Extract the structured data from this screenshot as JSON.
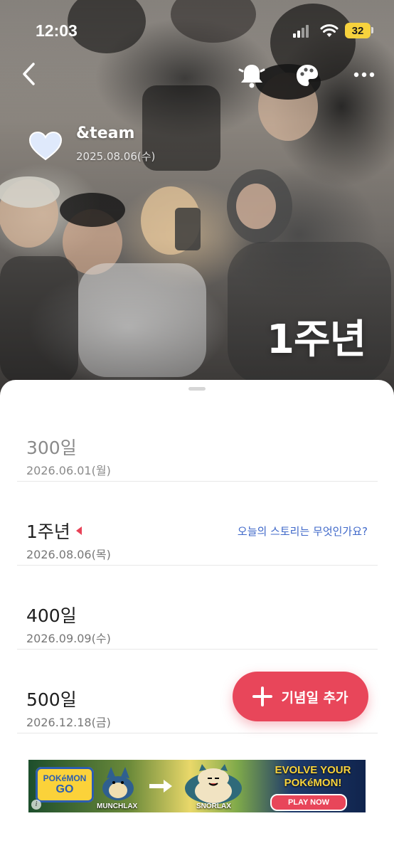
{
  "status_bar": {
    "time": "12:03",
    "battery": "32"
  },
  "header": {
    "group_name": "&team",
    "start_date": "2025.08.06(수)",
    "featured_milestone": "1주년"
  },
  "milestones": [
    {
      "title": "300일",
      "date": "2026.06.01(월)",
      "state": "past"
    },
    {
      "title": "1주년",
      "date": "2026.08.06(목)",
      "state": "current",
      "prompt": "오늘의 스토리는 무엇인가요?"
    },
    {
      "title": "400일",
      "date": "2026.09.09(수)",
      "state": "upcoming"
    },
    {
      "title": "500일",
      "date": "2026.12.18(금)",
      "state": "upcoming"
    }
  ],
  "fab": {
    "label": "기념일 추가",
    "color": "#e8465a"
  },
  "ad": {
    "logo_top": "POKéMON",
    "logo_bottom": "GO",
    "from_label": "MUNCHLAX",
    "to_label": "SNORLAX",
    "headline_1": "EVOLVE YOUR",
    "headline_2": "POKéMON!",
    "cta": "PLAY NOW",
    "info": "i"
  },
  "icons": [
    "back-icon",
    "bell-icon",
    "palette-icon",
    "more-icon",
    "heart-icon",
    "plus-icon",
    "info-icon"
  ],
  "colors": {
    "accent": "#e8465a",
    "link": "#3f68c9",
    "battery": "#f7d23d"
  }
}
